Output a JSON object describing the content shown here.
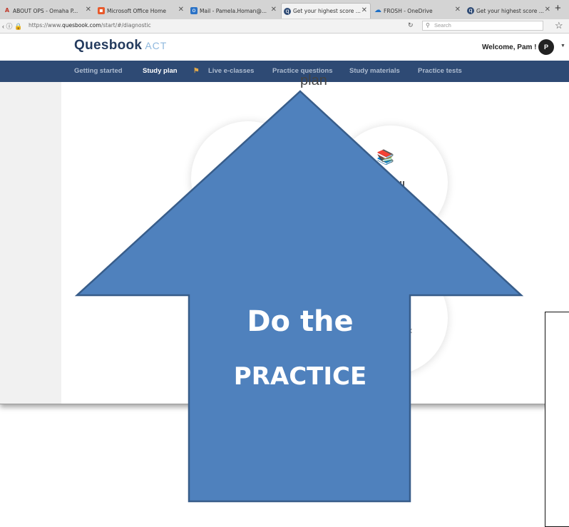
{
  "browser": {
    "tabs": [
      {
        "label": "ABOUT OPS - Omaha P...",
        "icon": "acrobat-icon",
        "active": false
      },
      {
        "label": "Microsoft Office Home",
        "icon": "office-icon",
        "active": false
      },
      {
        "label": "Mail - Pamela.Homan@...",
        "icon": "outlook-icon",
        "active": false
      },
      {
        "label": "Get your highest score ...",
        "icon": "quesbook-icon",
        "active": true
      },
      {
        "label": "FROSH - OneDrive",
        "icon": "onedrive-icon",
        "active": false
      },
      {
        "label": "Get your highest score ...",
        "icon": "quesbook-icon",
        "active": false
      }
    ],
    "new_tab_label": "+",
    "url_prefix": "https://www.",
    "url_domain": "quesbook.com",
    "url_path": "/start/#/diagnostic",
    "search_placeholder": "Search"
  },
  "app": {
    "logo_text": "Quesbook",
    "logo_suffix": "ACT",
    "welcome": "Welcome, Pam !",
    "avatar_initial": "P"
  },
  "nav": {
    "getting_started": "Getting started",
    "study_plan": "Study plan",
    "live_eclasses": "Live e-classes",
    "practice_questions": "Practice questions",
    "study_materials": "Study materials",
    "practice_tests": "Practice tests",
    "active": "Study plan"
  },
  "content": {
    "plan_heading": "plan"
  },
  "overlay": {
    "arrow_line1": "Do the",
    "arrow_line2": "PRACTICE",
    "arrow_color": "#4f81bd",
    "arrow_border": "#385d8a"
  }
}
